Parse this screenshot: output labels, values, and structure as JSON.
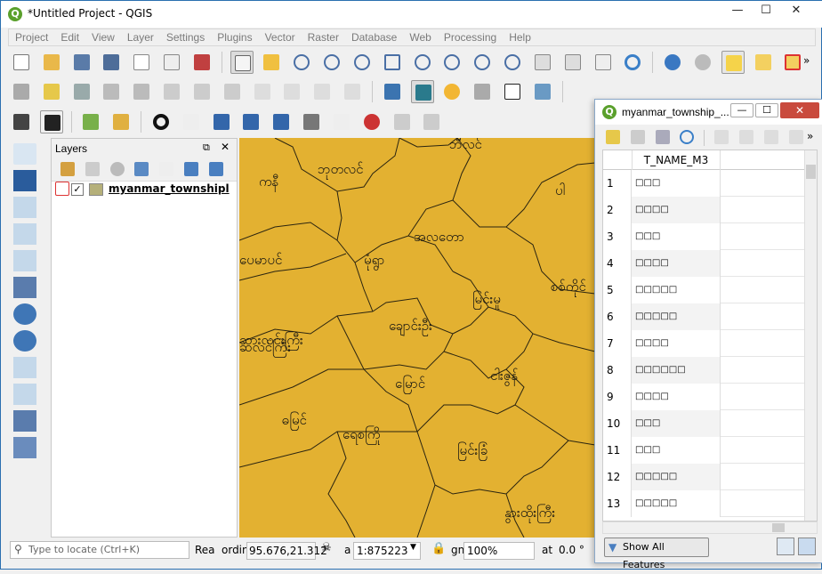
{
  "window": {
    "title": "*Untitled Project - QGIS",
    "app_icon": "Q"
  },
  "menu": [
    "Project",
    "Edit",
    "View",
    "Layer",
    "Settings",
    "Plugins",
    "Vector",
    "Raster",
    "Database",
    "Web",
    "Processing",
    "Help"
  ],
  "layers_panel": {
    "title": "Layers",
    "items": [
      {
        "name": "myanmar_townshipl",
        "checked": true,
        "swatch": "#b5b07a"
      }
    ]
  },
  "map": {
    "fill": "#e3b131",
    "labels": [
      "ဘီလင်",
      "ကနီ",
      "ဘုတလင်",
      "ပါ",
      "အလတော",
      "ပေမာပင်",
      "မုံရွာ",
      "ဆလင်ကြီး",
      "ချောင်းဦး",
      "မြင်းမူ",
      "စစ်ကိုင်",
      "ဆားလင်းကြီး",
      "မြောင်",
      "ငါးဇွန်",
      "ဓမြင်",
      "ရေစကြို",
      "မြင်းခြံ",
      "နွားထိုးကြီး"
    ]
  },
  "status": {
    "locate_placeholder": "Type to locate (Ctrl+K)",
    "ready_label": "Rea",
    "coord_label": "ordin",
    "coord_value": "95.676,21.312",
    "scale_label": "a",
    "scale_value": "1:875223",
    "mag_label": "gni",
    "mag_value": "100%",
    "rot_label": "at",
    "rot_value": "0.0 °"
  },
  "attribute_table": {
    "title": "myanmar_township_...",
    "column": "T_NAME_M3",
    "rows": [
      {
        "n": "1",
        "v": "□□□"
      },
      {
        "n": "2",
        "v": "□□□□"
      },
      {
        "n": "3",
        "v": "□□□"
      },
      {
        "n": "4",
        "v": "□□□□"
      },
      {
        "n": "5",
        "v": "□□□□□"
      },
      {
        "n": "6",
        "v": "□□□□□"
      },
      {
        "n": "7",
        "v": "□□□□"
      },
      {
        "n": "8",
        "v": "□□□□□□"
      },
      {
        "n": "9",
        "v": "□□□□"
      },
      {
        "n": "10",
        "v": "□□□"
      },
      {
        "n": "11",
        "v": "□□□"
      },
      {
        "n": "12",
        "v": "□□□□□"
      },
      {
        "n": "13",
        "v": "□□□□□"
      }
    ],
    "show_features_label": "Show All Features"
  }
}
